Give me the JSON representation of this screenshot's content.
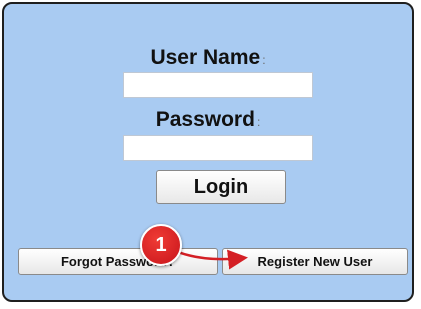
{
  "login_form": {
    "username_label": "User Name",
    "username_colon": ":",
    "username_value": "",
    "password_label": "Password",
    "password_colon": ":",
    "password_value": "",
    "login_button": "Login",
    "forgot_password_button": "Forgot Password?",
    "register_button": "Register New User"
  },
  "annotation": {
    "step_number": "1"
  },
  "colors": {
    "panel_background": "#a9cbf2",
    "badge_red": "#d41f25"
  }
}
